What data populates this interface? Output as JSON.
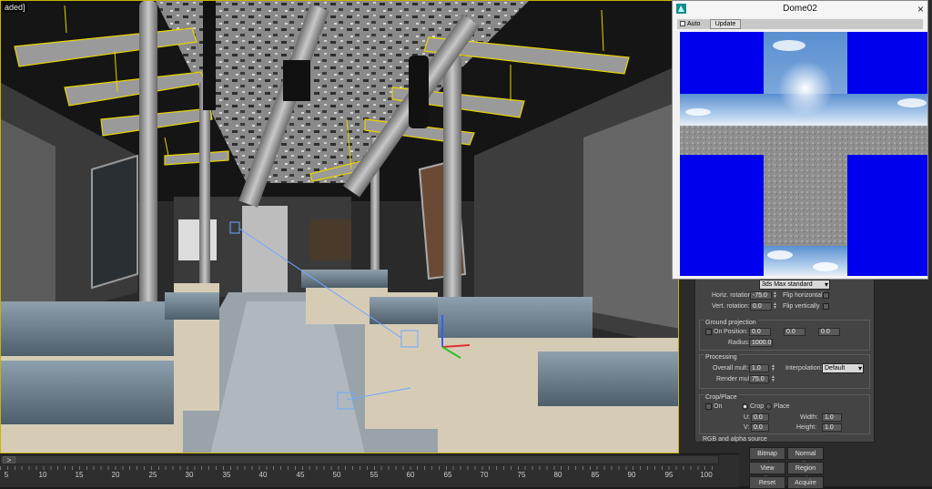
{
  "viewport": {
    "label": "aded] "
  },
  "timeline": {
    "thumb_label": ">",
    "ticks": [
      "5",
      "10",
      "15",
      "20",
      "25",
      "30",
      "35",
      "40",
      "45",
      "50",
      "55",
      "60",
      "65",
      "70",
      "75",
      "80",
      "85",
      "90",
      "95",
      "100"
    ]
  },
  "dome_window": {
    "title": "Dome02",
    "close": "×",
    "auto_label": "Auto",
    "update_label": "Update"
  },
  "params": {
    "map_dropdown": "3ds Max standard",
    "horiz_rotation_label": "Horiz. rotation:",
    "horiz_rotation_value": "-75.0",
    "vert_rotation_label": "Vert. rotation:",
    "vert_rotation_value": "0.0",
    "flip_h_label": "Flip horizontally",
    "flip_v_label": "Flip vertically",
    "ground_title": "Ground projection",
    "on_label": "On",
    "position_label": "Position:",
    "pos_x": "0.0",
    "pos_y": "0.0",
    "pos_z": "0.0",
    "radius_label": "Radius:",
    "radius_value": "1000.0",
    "processing_title": "Processing",
    "overall_mult_label": "Overall mult:",
    "overall_mult_value": "1.0",
    "render_mult_label": "Render mult:",
    "render_mult_value": "75.0",
    "interpolation_label": "Interpolation:",
    "interpolation_value": "Default",
    "crop_title": "Crop/Place",
    "crop_on_label": "On",
    "crop_label": "Crop",
    "place_label": "Place",
    "u_label": "U:",
    "u_value": "0.0",
    "v_label": "V:",
    "v_value": "0.0",
    "width_label": "Width:",
    "width_value": "1.0",
    "height_label": "Height:",
    "height_value": "1.0",
    "rgb_title": "RGB and alpha source"
  },
  "buttons": {
    "bitmap_fit": "Bitmap Fit",
    "normal_align": "Normal Align",
    "view_align": "View Align",
    "region_fit": "Region Fit",
    "reset": "Reset",
    "acquire": "Acquire"
  },
  "colors": {
    "viewport_border": "#c8b400",
    "dome_blue": "#0000ee",
    "sky": "#8fb6e0",
    "seat_fabric": "#6a7d8c"
  }
}
